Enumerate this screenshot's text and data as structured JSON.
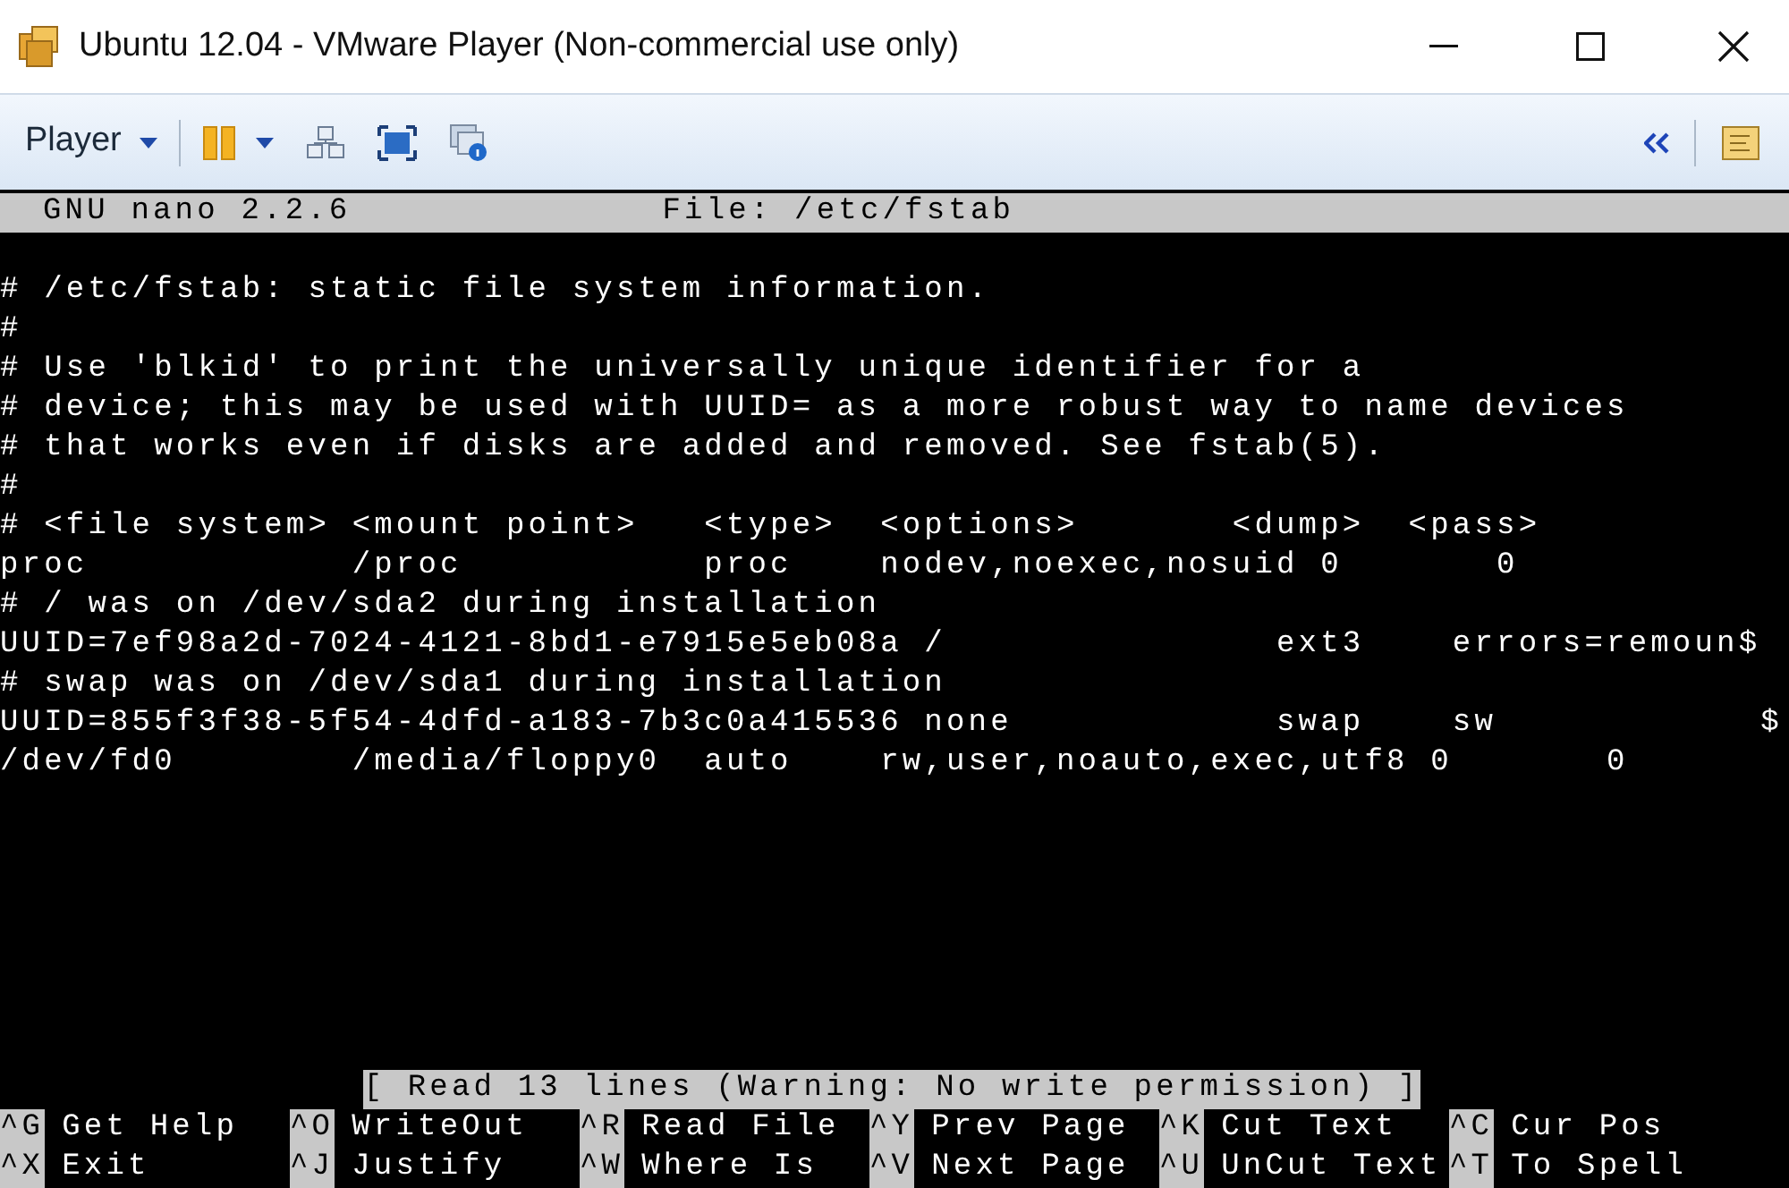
{
  "window": {
    "title": "Ubuntu 12.04 - VMware Player (Non-commercial use only)"
  },
  "toolbar": {
    "menu": "Player"
  },
  "editor": {
    "app": "GNU nano 2.2.6",
    "file": "File: /etc/fstab",
    "lines": [
      "# /etc/fstab: static file system information.",
      "#",
      "# Use 'blkid' to print the universally unique identifier for a",
      "# device; this may be used with UUID= as a more robust way to name devices",
      "# that works even if disks are added and removed. See fstab(5).",
      "#",
      "# <file system> <mount point>   <type>  <options>       <dump>  <pass>",
      "proc            /proc           proc    nodev,noexec,nosuid 0       0",
      "# / was on /dev/sda2 during installation",
      "UUID=7ef98a2d-7024-4121-8bd1-e7915e5eb08a /               ext3    errors=remoun$",
      "# swap was on /dev/sda1 during installation",
      "UUID=855f3f38-5f54-4dfd-a183-7b3c0a415536 none            swap    sw            $",
      "/dev/fd0        /media/floppy0  auto    rw,user,noauto,exec,utf8 0       0"
    ],
    "status": "[ Read 13 lines (Warning: No write permission) ]",
    "shortcuts": [
      [
        {
          "key": "^G",
          "label": "Get Help"
        },
        {
          "key": "^O",
          "label": "WriteOut"
        },
        {
          "key": "^R",
          "label": "Read File"
        },
        {
          "key": "^Y",
          "label": "Prev Page"
        },
        {
          "key": "^K",
          "label": "Cut Text"
        },
        {
          "key": "^C",
          "label": "Cur Pos"
        }
      ],
      [
        {
          "key": "^X",
          "label": "Exit"
        },
        {
          "key": "^J",
          "label": "Justify"
        },
        {
          "key": "^W",
          "label": "Where Is"
        },
        {
          "key": "^V",
          "label": "Next Page"
        },
        {
          "key": "^U",
          "label": "UnCut Text"
        },
        {
          "key": "^T",
          "label": "To Spell"
        }
      ]
    ]
  }
}
